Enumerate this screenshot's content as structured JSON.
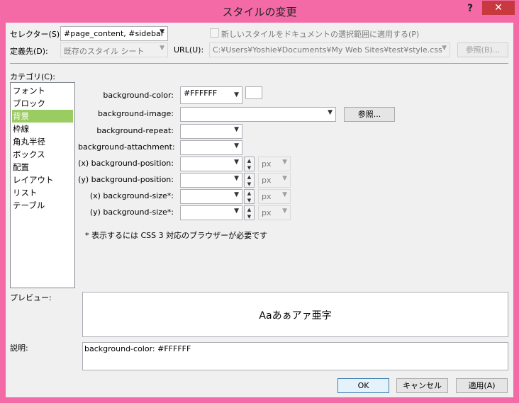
{
  "window": {
    "title": "スタイルの変更",
    "help_label": "?",
    "close_label": "✕"
  },
  "top": {
    "selector_label": "セレクター(S):",
    "selector_value": "#page_content, #sidebar",
    "new_style_checkbox_label": "新しいスタイルをドキュメントの選択範囲に適用する(P)",
    "define_in_label": "定義先(D):",
    "define_in_value": "既存のスタイル シート",
    "url_label": "URL(U):",
    "url_value": "C:¥Users¥Yoshie¥Documents¥My Web Sites¥test¥style.css",
    "browse_label": "参照(B)..."
  },
  "category": {
    "label": "カテゴリ(C):",
    "items": [
      "フォント",
      "ブロック",
      "背景",
      "枠線",
      "角丸半径",
      "ボックス",
      "配置",
      "レイアウト",
      "リスト",
      "テーブル"
    ],
    "selected": "背景"
  },
  "background": {
    "color_label": "background-color:",
    "color_value": "#FFFFFF",
    "color_swatch": "#FFFFFF",
    "image_label": "background-image:",
    "image_value": "",
    "image_browse_label": "参照...",
    "repeat_label": "background-repeat:",
    "attachment_label": "background-attachment:",
    "pos_x_label": "(x) background-position:",
    "pos_y_label": "(y) background-position:",
    "size_x_label": "(x) background-size*:",
    "size_y_label": "(y) background-size*:",
    "unit_value": "px",
    "css3_note": "* 表示するには CSS 3 対応のブラウザーが必要です"
  },
  "preview": {
    "label": "プレビュー:",
    "sample_text": "Aaあぁアァ亜字"
  },
  "description": {
    "label": "説明:",
    "text": "background-color: #FFFFFF"
  },
  "buttons": {
    "ok": "OK",
    "cancel": "キャンセル",
    "apply": "適用(A)"
  },
  "colors": {
    "titlebar": "#f36aa6",
    "close_button": "#c7383f",
    "selection": "#9bcc62",
    "client_bg": "#f0f0f0"
  }
}
